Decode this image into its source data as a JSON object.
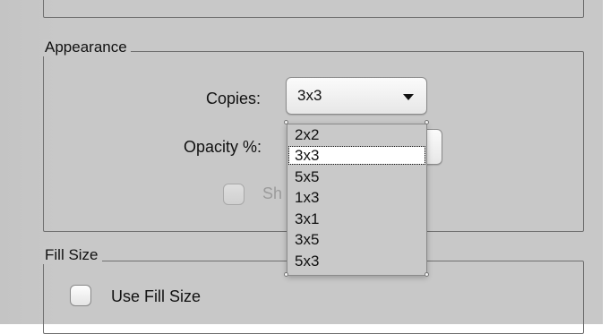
{
  "appearance": {
    "title": "Appearance",
    "copies_label": "Copies:",
    "copies_value": "3x3",
    "opacity_label": "Opacity %:",
    "show_label_partial": "Sh"
  },
  "fill_size": {
    "title": "Fill Size",
    "use_fill_size_label": "Use Fill Size",
    "use_fill_size_checked": false
  },
  "copies_menu": {
    "items": [
      "2x2",
      "3x3",
      "5x5",
      "1x3",
      "3x1",
      "3x5",
      "5x3"
    ],
    "selected": "3x3"
  },
  "icons": {
    "dropdown": "dropdown-arrow-icon"
  }
}
